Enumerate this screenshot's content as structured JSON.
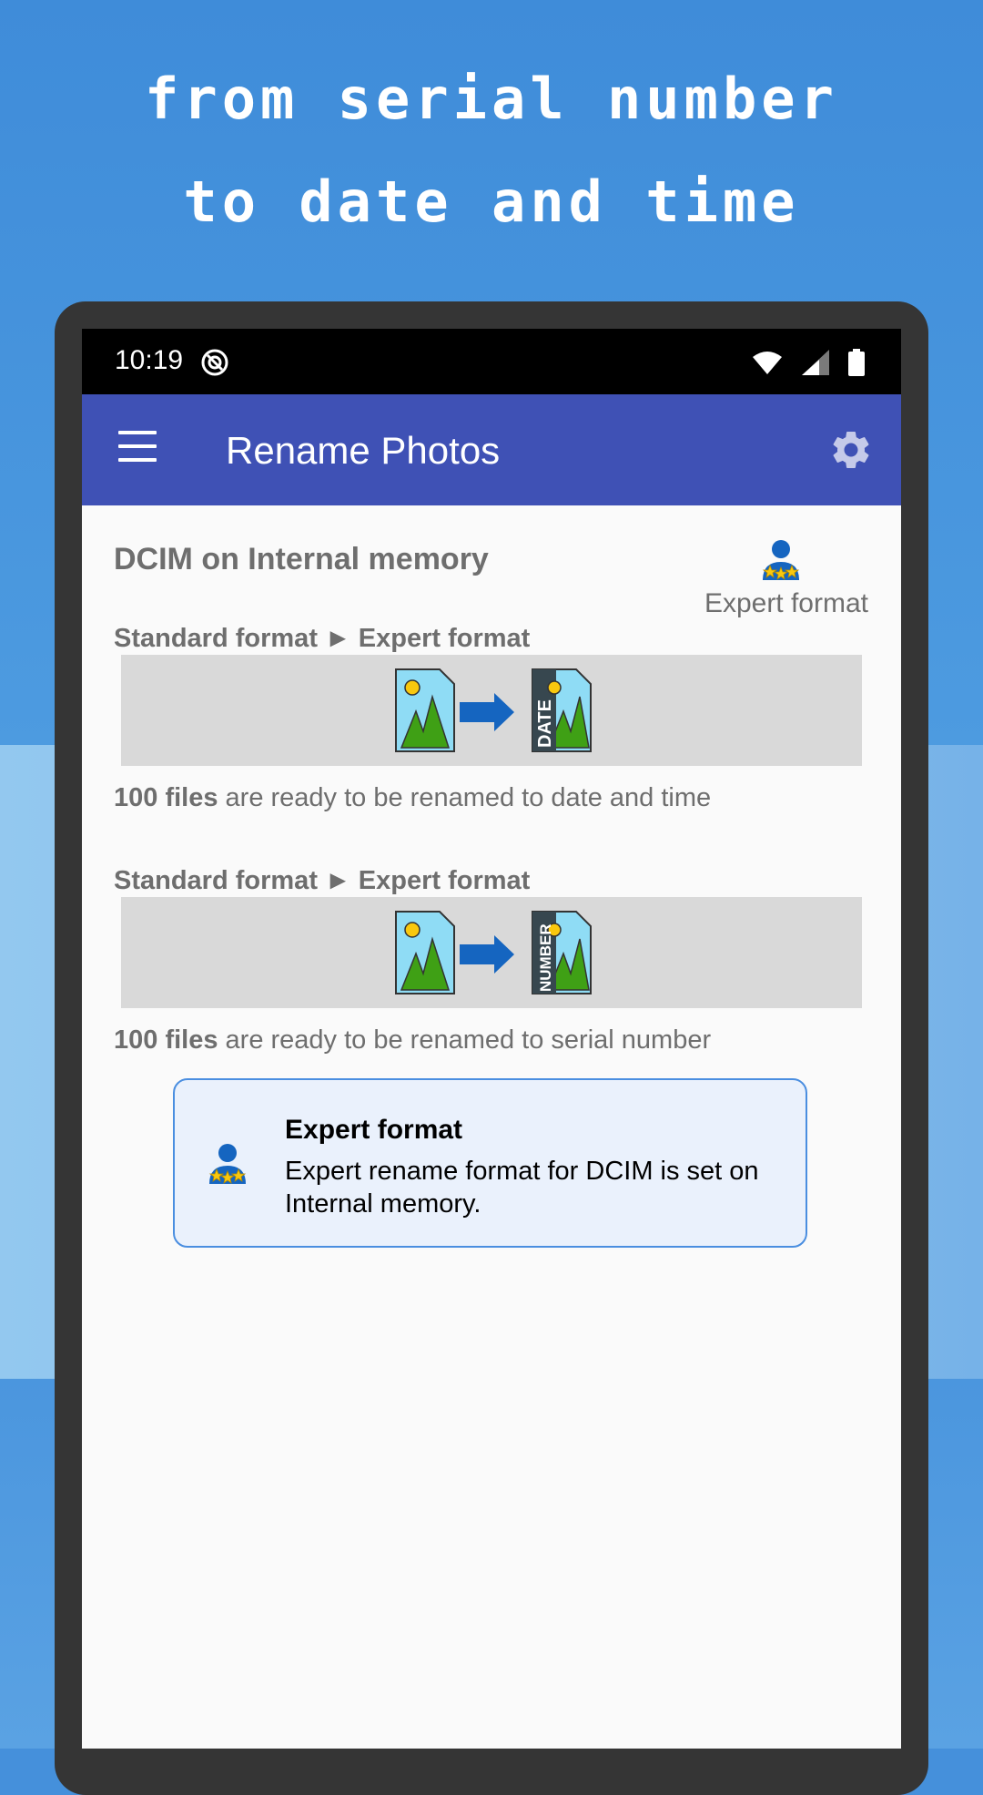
{
  "promo": {
    "headline_line1": "from serial number",
    "headline_line2": "to date and time"
  },
  "status_bar": {
    "time": "10:19",
    "icons": [
      "do-not-disturb-icon",
      "wifi-icon",
      "cellular-signal-icon",
      "battery-icon"
    ]
  },
  "app_bar": {
    "title": "Rename Photos",
    "menu_icon": "hamburger-menu-icon",
    "settings_icon": "gear-icon",
    "color": "#3f51b5"
  },
  "storage": {
    "title": "DCIM on Internal memory",
    "badge_label": "Expert format"
  },
  "conversions": [
    {
      "label": "Standard format ► Expert format",
      "target_tag": "DATE",
      "ready_count": "100 files",
      "ready_text": " are ready to be renamed to date and time"
    },
    {
      "label": "Standard format ► Expert format",
      "target_tag": "NUMBER",
      "ready_count": "100 files",
      "ready_text": " are ready to be renamed to serial number"
    }
  ],
  "toast": {
    "title": "Expert format",
    "message": "Expert rename format for DCIM is set on Internal memory.",
    "border_color": "#4a8ee0"
  }
}
